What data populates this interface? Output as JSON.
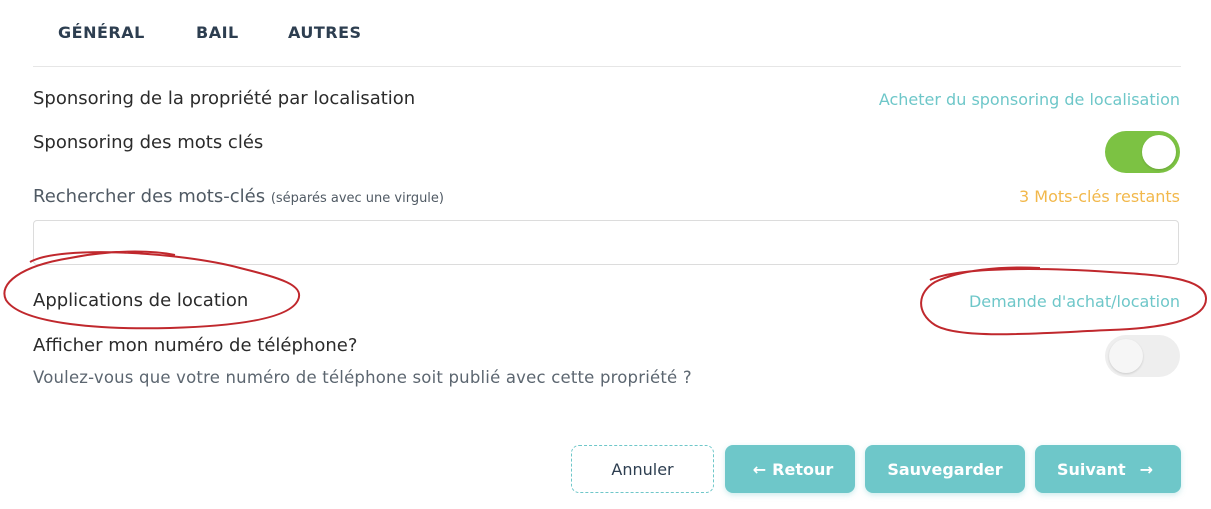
{
  "tabs": [
    {
      "label": "GÉNÉRAL"
    },
    {
      "label": "BAIL"
    },
    {
      "label": "AUTRES"
    }
  ],
  "location_sponsoring": {
    "label": "Sponsoring de la propriété par localisation",
    "link": "Acheter du sponsoring de localisation"
  },
  "keyword_sponsoring": {
    "label": "Sponsoring des mots clés",
    "toggle_on": true
  },
  "keyword_search": {
    "label": "Rechercher des mots-clés",
    "hint": "(séparés avec une virgule)",
    "remaining": "3 Mots-clés restants",
    "value": "",
    "placeholder": ""
  },
  "rental_applications": {
    "label": "Applications de location",
    "link": "Demande d'achat/location"
  },
  "phone": {
    "label": "Afficher mon numéro de téléphone?",
    "description": "Voulez-vous que votre numéro de téléphone soit publié avec cette propriété ?",
    "toggle_on": false
  },
  "buttons": {
    "cancel": "Annuler",
    "back": "Retour",
    "save": "Sauvegarder",
    "next": "Suivant"
  },
  "colors": {
    "accent": "#6ec7c9",
    "toggle_on": "#7cc243",
    "warning": "#f2b84b",
    "annotation": "#c0282d"
  }
}
